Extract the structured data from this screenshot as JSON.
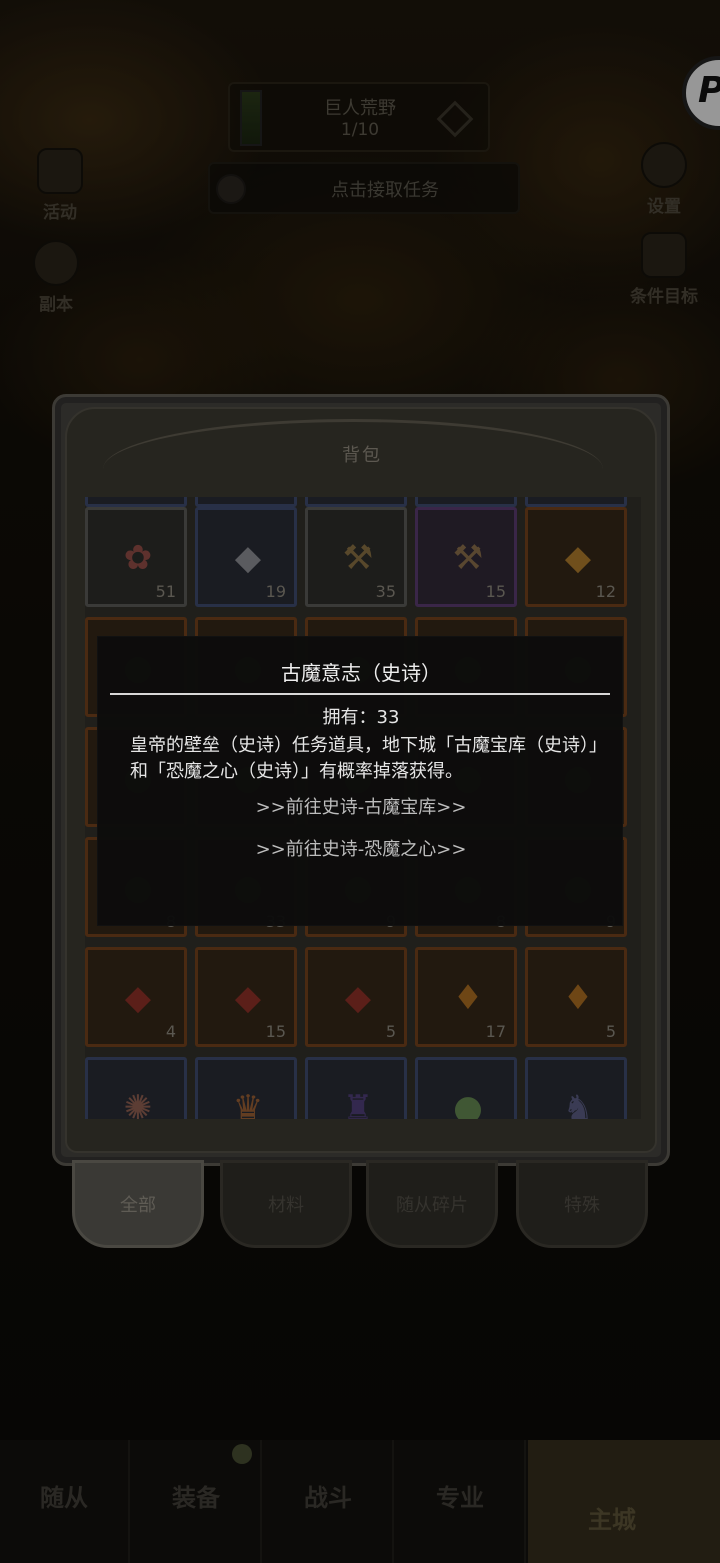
{
  "hud": {
    "quest_title": "巨人荒野",
    "quest_progress": "1/10",
    "task_prompt": "点击接取任务",
    "left_buttons": [
      {
        "label": "活动",
        "icon": "calendar-icon"
      },
      {
        "label": "副本",
        "icon": "portal-icon"
      }
    ],
    "right_buttons": [
      {
        "label": "设置",
        "icon": "gear-icon"
      },
      {
        "label": "条件目标",
        "icon": "book-icon"
      }
    ],
    "corner_badge": "P"
  },
  "bag": {
    "title": "背包",
    "rows": [
      [
        {
          "count": "51",
          "quality": "gray",
          "icon": "ore-icon"
        },
        {
          "count": "19",
          "quality": "blue",
          "icon": "stone-icon"
        },
        {
          "count": "35",
          "quality": "gray",
          "icon": "pickaxe-icon"
        },
        {
          "count": "15",
          "quality": "purple",
          "icon": "pickaxe-icon"
        },
        {
          "count": "12",
          "quality": "orange",
          "icon": "gold-ore-icon"
        }
      ],
      [
        {
          "count": "",
          "quality": "orange",
          "icon": "gem-icon"
        },
        {
          "count": "",
          "quality": "orange",
          "icon": "gem-icon"
        },
        {
          "count": "",
          "quality": "orange",
          "icon": "gem-icon"
        },
        {
          "count": "",
          "quality": "orange",
          "icon": "gem-icon"
        },
        {
          "count": "",
          "quality": "orange",
          "icon": "gem-icon"
        }
      ],
      [
        {
          "count": "",
          "quality": "orange",
          "icon": "gem-icon"
        },
        {
          "count": "",
          "quality": "orange",
          "icon": "gem-icon"
        },
        {
          "count": "",
          "quality": "orange",
          "icon": "gem-icon"
        },
        {
          "count": "",
          "quality": "orange",
          "icon": "gem-icon"
        },
        {
          "count": "",
          "quality": "orange",
          "icon": "gem-icon"
        }
      ],
      [
        {
          "count": "8",
          "quality": "orange",
          "icon": "gem-icon"
        },
        {
          "count": "33",
          "quality": "orange",
          "icon": "gem-icon"
        },
        {
          "count": "9",
          "quality": "orange",
          "icon": "gem-icon"
        },
        {
          "count": "8",
          "quality": "orange",
          "icon": "gem-icon"
        },
        {
          "count": "9",
          "quality": "orange",
          "icon": "gem-icon"
        }
      ],
      [
        {
          "count": "4",
          "quality": "orange",
          "icon": "red-gem-icon"
        },
        {
          "count": "15",
          "quality": "orange",
          "icon": "red-gem-icon"
        },
        {
          "count": "5",
          "quality": "orange",
          "icon": "red-gem-icon"
        },
        {
          "count": "17",
          "quality": "orange",
          "icon": "flame-gem-icon"
        },
        {
          "count": "5",
          "quality": "orange",
          "icon": "flame-gem-icon"
        }
      ],
      [
        {
          "count": "",
          "quality": "blue",
          "icon": "crest-icon"
        },
        {
          "count": "",
          "quality": "blue",
          "icon": "crown-icon"
        },
        {
          "count": "",
          "quality": "blue",
          "icon": "helm-icon"
        },
        {
          "count": "",
          "quality": "blue",
          "icon": "orb-icon"
        },
        {
          "count": "",
          "quality": "blue",
          "icon": "pet-icon"
        }
      ]
    ],
    "tabs": [
      {
        "label": "全部",
        "active": true
      },
      {
        "label": "材料",
        "active": false
      },
      {
        "label": "随从碎片",
        "active": false
      },
      {
        "label": "特殊",
        "active": false
      }
    ]
  },
  "tooltip": {
    "title": "古魔意志（史诗）",
    "owned": "拥有：33",
    "description": "皇帝的壁垒（史诗）任务道具，地下城「古魔宝库（史诗）」和「恐魔之心（史诗）」有概率掉落获得。",
    "link_1": ">>前往史诗-古魔宝库>>",
    "link_2": ">>前往史诗-恐魔之心>>"
  },
  "bottom_nav": {
    "items": [
      "随从",
      "装备",
      "战斗",
      "专业"
    ],
    "home": "主城"
  },
  "colors": {
    "quality_gray": "#3a3a38",
    "quality_blue": "#283047",
    "quality_purple": "#3a2648",
    "quality_orange": "#4a2a12",
    "tooltip_bg": "#0c0c0c",
    "tooltip_text": "#e6e6e6"
  }
}
